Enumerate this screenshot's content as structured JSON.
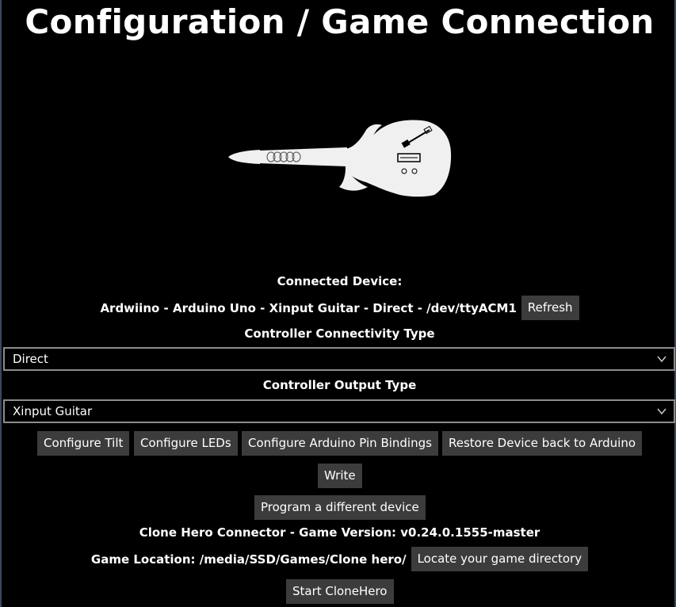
{
  "header": {
    "title": "Configuration / Game Connection"
  },
  "device": {
    "heading": "Connected Device:",
    "name": "Ardwiino - Arduino Uno - Xinput Guitar - Direct - /dev/ttyACM1",
    "refresh_label": "Refresh"
  },
  "connectivity": {
    "label": "Controller Connectivity Type",
    "selected": "Direct"
  },
  "output": {
    "label": "Controller Output Type",
    "selected": "Xinput Guitar"
  },
  "actions": {
    "configure_tilt": "Configure Tilt",
    "configure_leds": "Configure LEDs",
    "configure_pins": "Configure Arduino Pin Bindings",
    "restore": "Restore Device back to Arduino",
    "write": "Write",
    "program_other": "Program a different device"
  },
  "game": {
    "connector": "Clone Hero Connector - Game Version: v0.24.0.1555-master",
    "location": "Game Location: /media/SSD/Games/Clone hero/",
    "locate_label": "Locate your game directory",
    "start_label": "Start CloneHero"
  },
  "icons": {
    "guitar": "guitar-icon",
    "dropdown": "chevron-down-icon"
  },
  "colors": {
    "background": "#000000",
    "button": "#3c3c3c",
    "select_border": "#8c8c8c",
    "guitar_fill": "#f0f0f0"
  }
}
